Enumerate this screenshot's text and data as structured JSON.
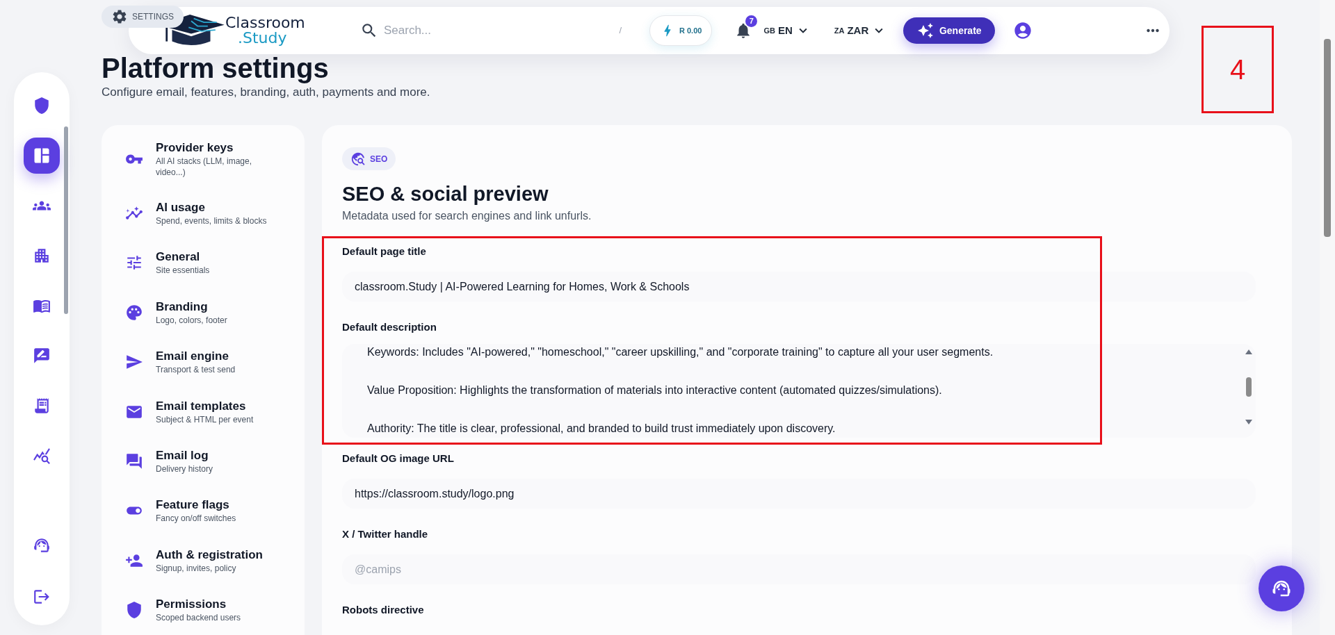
{
  "header": {
    "logo": {
      "name": "Classroom",
      "suffix": ".Study"
    },
    "search": {
      "placeholder": "Search...",
      "shortcut": "/"
    },
    "balance": "R 0.00",
    "notifications": {
      "count": "7"
    },
    "language": {
      "flag": "GB",
      "label": "EN"
    },
    "currency": {
      "flag": "ZA",
      "label": "ZAR"
    },
    "generate_button": "Generate"
  },
  "page": {
    "badge": "SETTINGS",
    "title": "Platform settings",
    "subtitle": "Configure email, features, branding, auth, payments and more."
  },
  "rail": {
    "items": [
      {
        "selected": false
      },
      {
        "selected": true
      },
      {
        "selected": false
      },
      {
        "selected": false
      },
      {
        "selected": false
      },
      {
        "selected": false
      },
      {
        "selected": false
      },
      {
        "selected": false
      }
    ]
  },
  "settings_menu": [
    {
      "title": "Provider keys",
      "subtitle": "All AI stacks (LLM, image, video...)"
    },
    {
      "title": "AI usage",
      "subtitle": "Spend, events, limits & blocks"
    },
    {
      "title": "General",
      "subtitle": "Site essentials"
    },
    {
      "title": "Branding",
      "subtitle": "Logo, colors, footer"
    },
    {
      "title": "Email engine",
      "subtitle": "Transport & test send"
    },
    {
      "title": "Email templates",
      "subtitle": "Subject & HTML per event"
    },
    {
      "title": "Email log",
      "subtitle": "Delivery history"
    },
    {
      "title": "Feature flags",
      "subtitle": "Fancy on/off switches"
    },
    {
      "title": "Auth & registration",
      "subtitle": "Signup, invites, policy"
    },
    {
      "title": "Permissions",
      "subtitle": "Scoped backend users"
    }
  ],
  "section": {
    "badge": "SEO",
    "title": "SEO & social preview",
    "subtitle": "Metadata used for search engines and link unfurls.",
    "fields": [
      {
        "kind": "input",
        "label": "Default page title",
        "value": "classroom.Study | AI-Powered Learning for Homes, Work & Schools"
      },
      {
        "kind": "textarea",
        "label": "Default description",
        "lines": [
          "Keywords: Includes \"AI-powered,\" \"homeschool,\" \"career upskilling,\" and \"corporate training\" to capture all your user segments.",
          "Value Proposition: Highlights the transformation of materials into interactive content (automated quizzes/simulations).",
          "Authority: The title is clear, professional, and branded to build trust immediately upon discovery."
        ]
      },
      {
        "kind": "input",
        "label": "Default OG image URL",
        "value": "https://classroom.study/logo.png"
      },
      {
        "kind": "input",
        "label": "X / Twitter handle",
        "placeholder": "@camips"
      },
      {
        "kind": "input",
        "label": "Robots directive"
      }
    ]
  },
  "annotations": [
    {
      "kind": "number",
      "label": "4"
    },
    {
      "kind": "frame"
    }
  ]
}
